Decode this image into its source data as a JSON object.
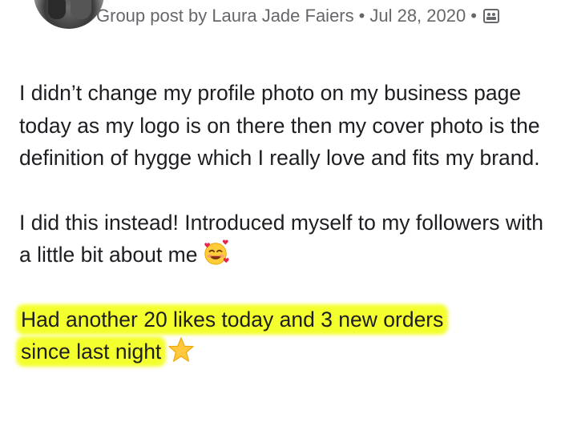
{
  "post": {
    "author_prefix": "Group post by",
    "author_name": "Laura Jade Faiers",
    "separator": "•",
    "date_line1": "Jul 28,",
    "date_line2": "2020",
    "audience_icon": "group-icon"
  },
  "content": {
    "paragraph1": "I didn’t change my profile photo on my business page today as my logo is on there then my cover photo is the definition of hygge which I really love and fits my brand.",
    "paragraph2": "I did this instead! Introduced myself to my followers with a little bit about me",
    "paragraph2_emoji": "smiling-face-with-hearts-emoji",
    "paragraph3_line1": "Had another 20 likes today and 3 new orders",
    "paragraph3_line2": "since last night",
    "paragraph3_emoji": "star-emoji"
  },
  "colors": {
    "meta_text": "#65676b",
    "body_text": "#1c1e21",
    "highlight": "#f4ff2e"
  }
}
